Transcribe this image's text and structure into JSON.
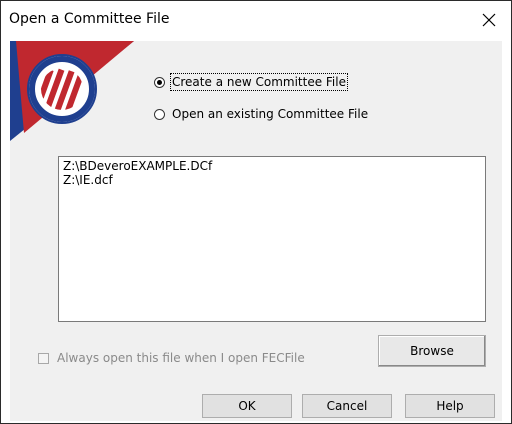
{
  "window": {
    "title": "Open a Committee File",
    "close_glyph": "✕"
  },
  "logo": {
    "icon": "fec-seal-logo",
    "colors": {
      "blue": "#1f3f8f",
      "red": "#c0282f",
      "white": "#ffffff"
    }
  },
  "options": {
    "create_new": {
      "label": "Create a new Committee File",
      "checked": true
    },
    "open_existing": {
      "label": "Open an existing Committee File",
      "checked": false
    }
  },
  "file_list": {
    "items": [
      "Z:\\BDeveroEXAMPLE.DCf",
      "Z:\\IE.dcf"
    ]
  },
  "always_open": {
    "label": "Always open this file when I open FECFile",
    "checked": false,
    "enabled": false
  },
  "buttons": {
    "browse": "Browse",
    "ok": "OK",
    "cancel": "Cancel",
    "help": "Help"
  }
}
